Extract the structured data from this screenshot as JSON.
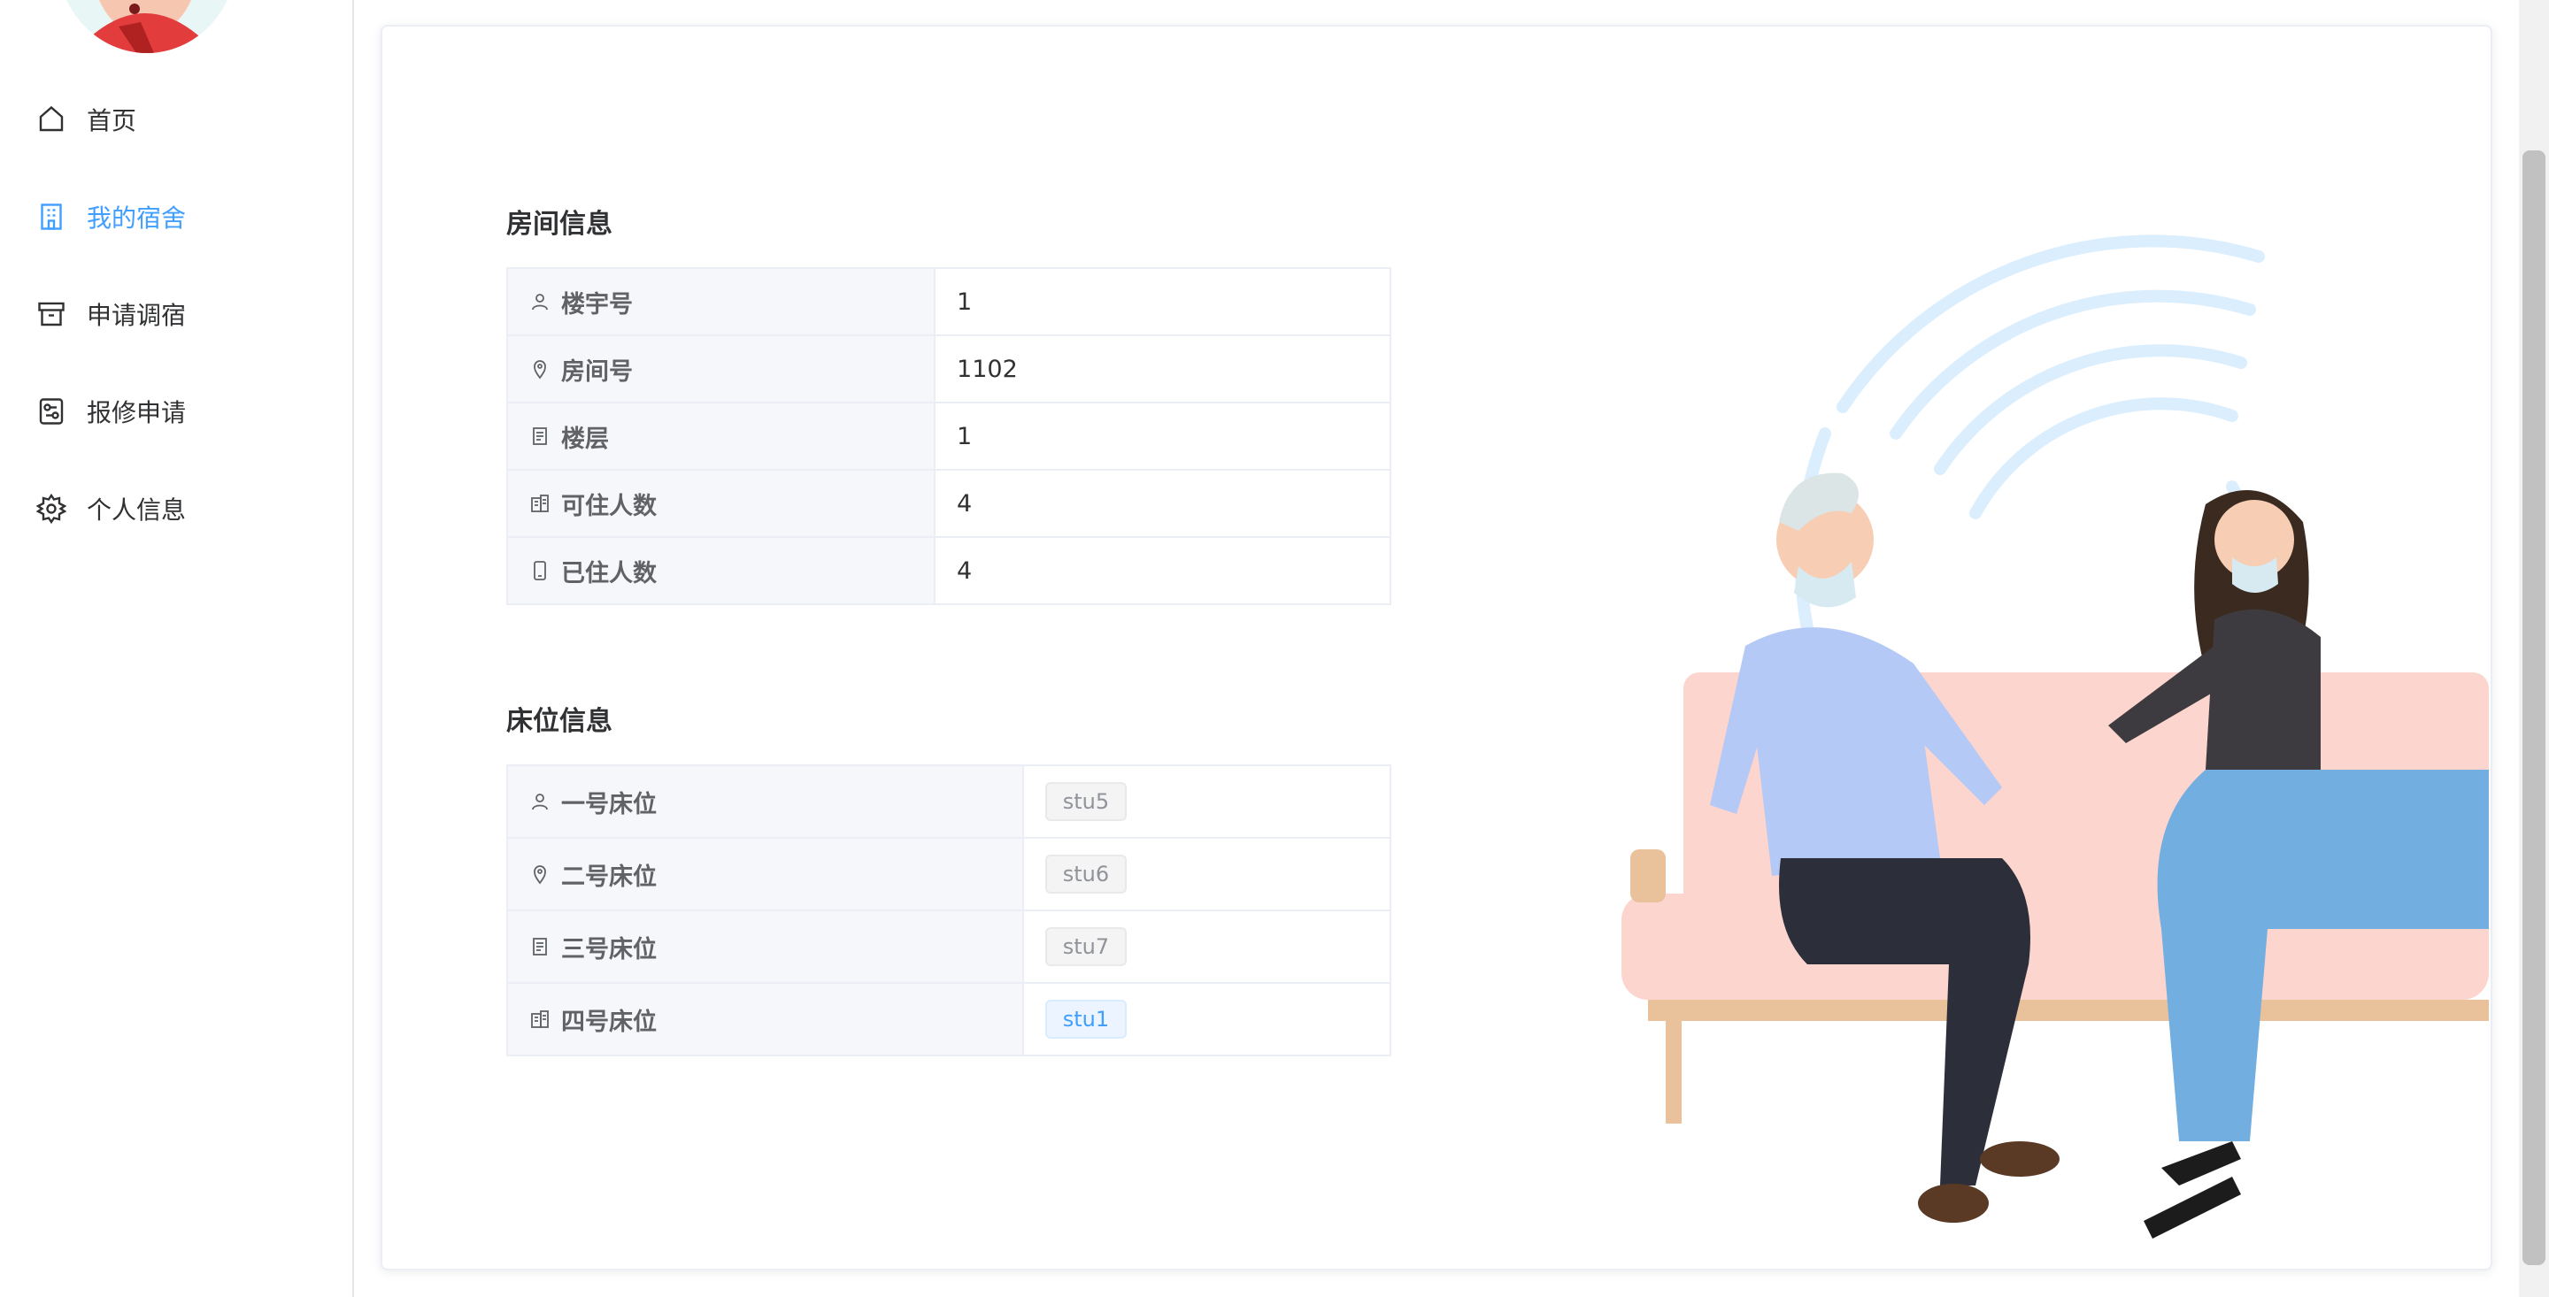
{
  "sidebar": {
    "items": [
      {
        "label": "首页",
        "icon": "home-icon",
        "active": false
      },
      {
        "label": "我的宿舍",
        "icon": "building-icon",
        "active": true
      },
      {
        "label": "申请调宿",
        "icon": "archive-icon",
        "active": false
      },
      {
        "label": "报修申请",
        "icon": "wrench-panel-icon",
        "active": false
      },
      {
        "label": "个人信息",
        "icon": "gear-icon",
        "active": false
      }
    ]
  },
  "room": {
    "title": "房间信息",
    "rows": [
      {
        "label": "楼宇号",
        "value": "1",
        "icon": "user-icon"
      },
      {
        "label": "房间号",
        "value": "1102",
        "icon": "location-icon"
      },
      {
        "label": "楼层",
        "value": "1",
        "icon": "document-icon"
      },
      {
        "label": "可住人数",
        "value": "4",
        "icon": "office-building-icon"
      },
      {
        "label": "已住人数",
        "value": "4",
        "icon": "mobile-icon"
      }
    ]
  },
  "beds": {
    "title": "床位信息",
    "rows": [
      {
        "label": "一号床位",
        "value": "stu5",
        "icon": "user-icon",
        "tag": "info"
      },
      {
        "label": "二号床位",
        "value": "stu6",
        "icon": "location-icon",
        "tag": "info"
      },
      {
        "label": "三号床位",
        "value": "stu7",
        "icon": "document-icon",
        "tag": "info"
      },
      {
        "label": "四号床位",
        "value": "stu1",
        "icon": "office-building-icon",
        "tag": "primary"
      }
    ]
  },
  "colors": {
    "accent": "#409eff",
    "label_bg": "#f5f7fa",
    "border": "#ebeef5"
  }
}
